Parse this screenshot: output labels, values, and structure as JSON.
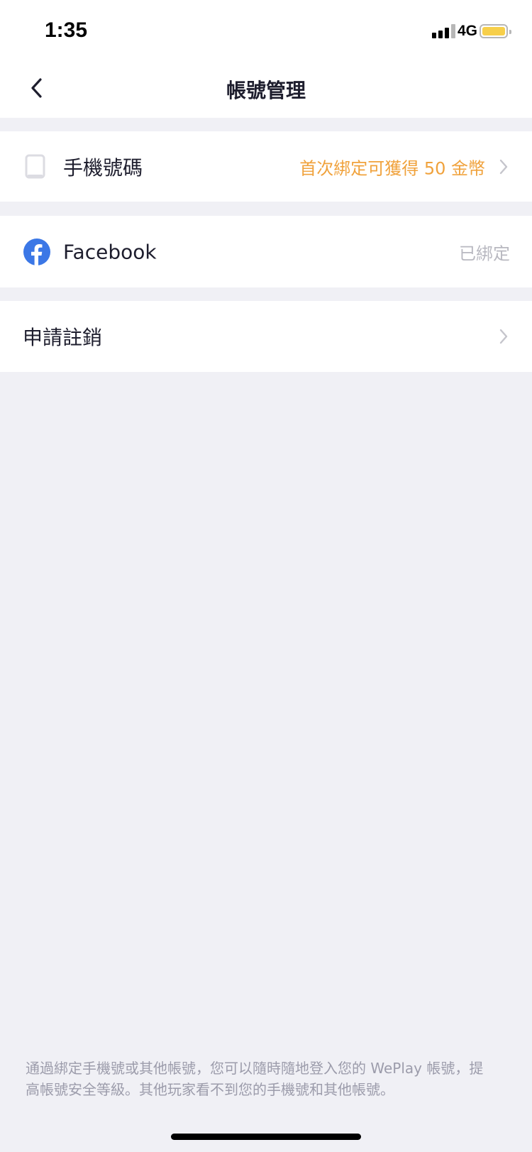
{
  "status_bar": {
    "time": "1:35",
    "network": "4G",
    "battery_color": "#f7cf4a"
  },
  "nav": {
    "title": "帳號管理",
    "back_icon": "chevron-left-icon"
  },
  "rows": [
    {
      "icon": "phone-icon",
      "label": "手機號碼",
      "value": "首次綁定可獲得 50 金幣",
      "value_color": "#f0a23c",
      "has_chevron": true
    },
    {
      "icon": "facebook-icon",
      "label": "Facebook",
      "value": "已綁定",
      "value_color": "#b8b8c0",
      "has_chevron": false
    },
    {
      "label": "申請註銷",
      "has_chevron": true
    }
  ],
  "footer": {
    "note": "通過綁定手機號或其他帳號，您可以隨時隨地登入您的 WePlay 帳號，提高帳號安全等級。其他玩家看不到您的手機號和其他帳號。"
  },
  "colors": {
    "background": "#f0f0f5",
    "facebook_blue": "#3b77e6"
  }
}
